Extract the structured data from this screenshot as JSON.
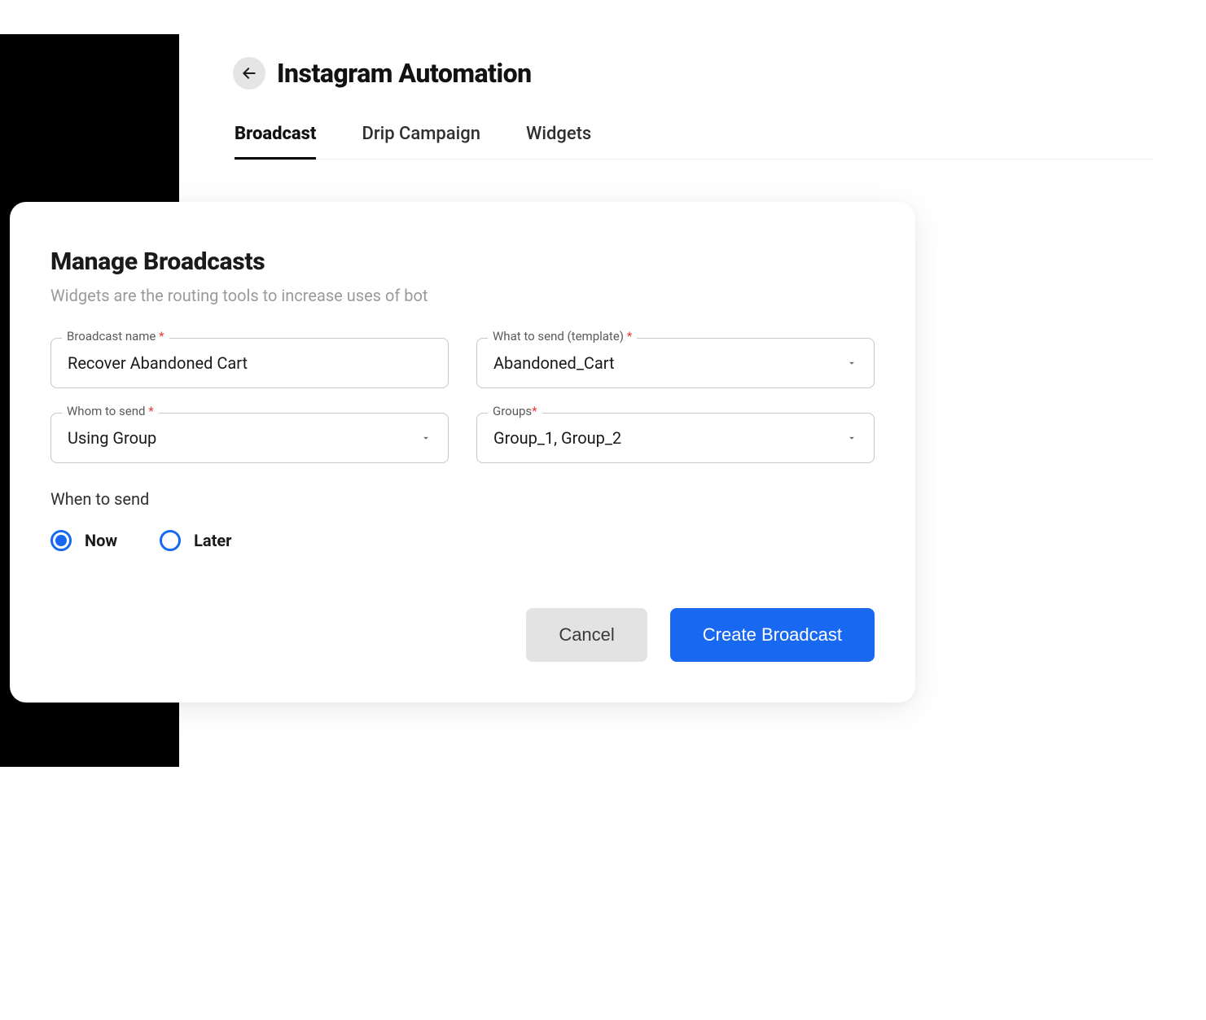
{
  "header": {
    "title": "Instagram Automation"
  },
  "tabs": [
    {
      "label": "Broadcast",
      "active": true
    },
    {
      "label": "Drip Campaign",
      "active": false
    },
    {
      "label": "Widgets",
      "active": false
    }
  ],
  "modal": {
    "title": "Manage Broadcasts",
    "subtitle": "Widgets are the routing tools to increase uses of bot",
    "fields": {
      "broadcast_name": {
        "label": "Broadcast name",
        "required": "*",
        "value": "Recover Abandoned Cart"
      },
      "template": {
        "label": "What to send (template)",
        "required": "*",
        "value": "Abandoned_Cart"
      },
      "whom": {
        "label": "Whom to send",
        "required": "*",
        "value": "Using Group"
      },
      "groups": {
        "label": "Groups",
        "required": "*",
        "value": "Group_1, Group_2"
      }
    },
    "when": {
      "label": "When to send",
      "options": [
        {
          "label": "Now",
          "selected": true
        },
        {
          "label": "Later",
          "selected": false
        }
      ]
    },
    "buttons": {
      "cancel": "Cancel",
      "create": "Create Broadcast"
    }
  }
}
